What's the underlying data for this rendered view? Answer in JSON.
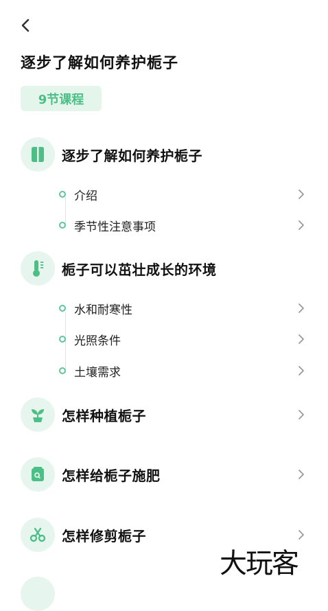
{
  "header": {
    "title": "逐步了解如何养护栀子",
    "badge": "9节课程"
  },
  "sections": [
    {
      "title": "逐步了解如何养护栀子",
      "icon": "book-icon",
      "lessons": [
        {
          "label": "介绍"
        },
        {
          "label": "季节性注意事项"
        }
      ]
    },
    {
      "title": "栀子可以茁壮成长的环境",
      "icon": "thermometer-icon",
      "lessons": [
        {
          "label": "水和耐寒性"
        },
        {
          "label": "光照条件"
        },
        {
          "label": "土壤需求"
        }
      ]
    },
    {
      "title": "怎样种植栀子",
      "icon": "sprout-icon"
    },
    {
      "title": "怎样给栀子施肥",
      "icon": "fertilizer-bag-icon"
    },
    {
      "title": "怎样修剪栀子",
      "icon": "scissors-icon"
    }
  ],
  "colors": {
    "accent": "#4cbf86",
    "icon_bg": "#e6f6ee",
    "badge_bg": "#e4f6ec"
  },
  "watermark": "大玩客"
}
